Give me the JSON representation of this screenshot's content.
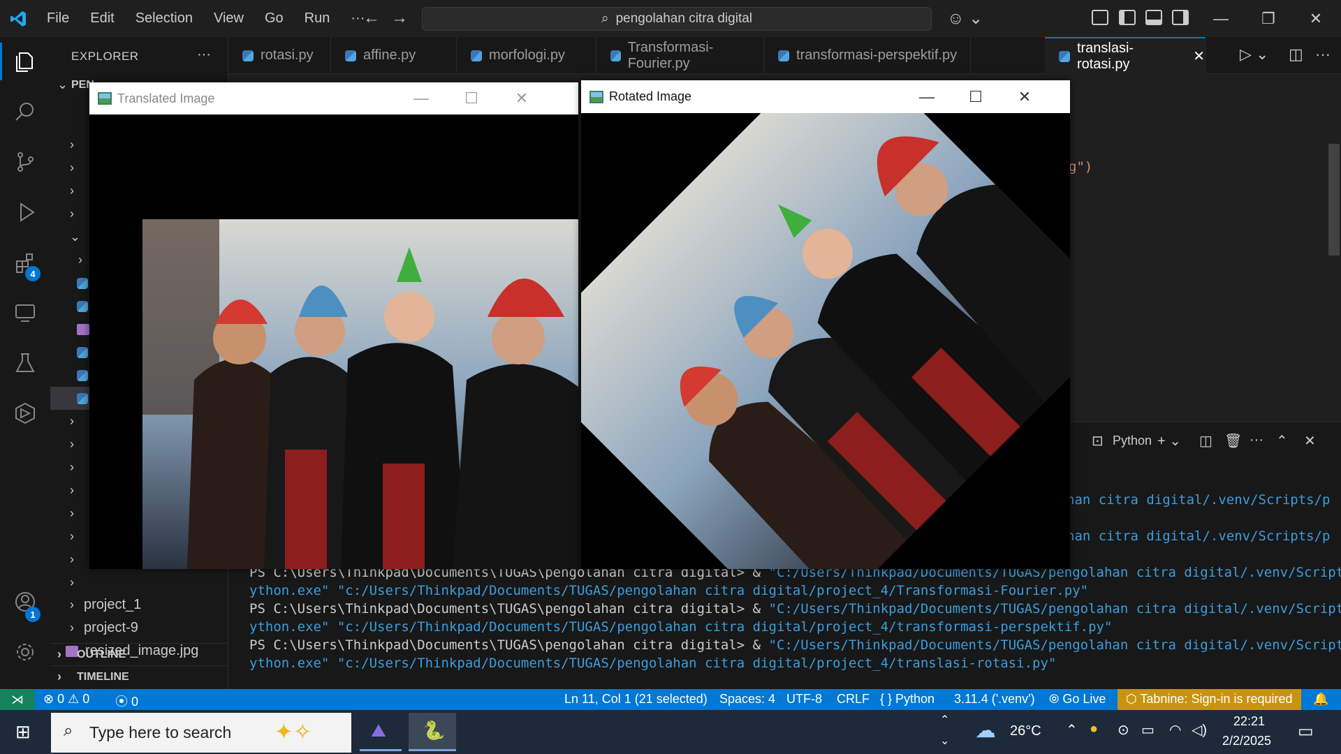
{
  "menu": [
    "File",
    "Edit",
    "Selection",
    "View",
    "Go",
    "Run",
    "···"
  ],
  "command_center": "pengolahan citra digital",
  "explorer": {
    "title": "EXPLORER",
    "root_label": "PEN",
    "items": [
      "project_1",
      "project-9",
      "resized_image.jpg"
    ],
    "outline": "OUTLINE",
    "timeline": "TIMELINE"
  },
  "tabs": [
    {
      "label": "rotasi.py"
    },
    {
      "label": "affine.py"
    },
    {
      "label": "morfologi.py"
    },
    {
      "label": "Transformasi-Fourier.py"
    },
    {
      "label": "transformasi-perspektif.py"
    },
    {
      "label": "translasi-rotasi.py"
    }
  ],
  "editor": {
    "visible_fragment": "g\")"
  },
  "badges": {
    "extensions": "4",
    "accounts": "1"
  },
  "panel": {
    "terminal_label": "Python",
    "lines": [
      {
        "plain": "",
        "str": "han citra digital/.venv/Scripts/p"
      },
      {
        "plain": "",
        "str": "han citra digital/.venv/Scripts/p"
      },
      {
        "plain": "PS C:\\Users\\Thinkpad\\Documents\\TUGAS\\pengolahan citra digital> & ",
        "str": "\"C:/Users/Thinkpad/Documents/TUGAS/pengolahan citra digital/.venv/Scripts/p"
      },
      {
        "plain": "",
        "str": "ython.exe\" \"c:/Users/Thinkpad/Documents/TUGAS/pengolahan citra digital/project_4/Transformasi-Fourier.py\""
      },
      {
        "plain": "PS C:\\Users\\Thinkpad\\Documents\\TUGAS\\pengolahan citra digital> & ",
        "str": "\"C:/Users/Thinkpad/Documents/TUGAS/pengolahan citra digital/.venv/Scripts/p"
      },
      {
        "plain": "",
        "str": "ython.exe\" \"c:/Users/Thinkpad/Documents/TUGAS/pengolahan citra digital/project_4/transformasi-perspektif.py\""
      },
      {
        "plain": "PS C:\\Users\\Thinkpad\\Documents\\TUGAS\\pengolahan citra digital> & ",
        "str": "\"C:/Users/Thinkpad/Documents/TUGAS/pengolahan citra digital/.venv/Scripts/p"
      },
      {
        "plain": "",
        "str": "ython.exe\" \"c:/Users/Thinkpad/Documents/TUGAS/pengolahan citra digital/project_4/translasi-rotasi.py\""
      }
    ]
  },
  "status": {
    "errors": "0",
    "warnings": "0",
    "ports": "0",
    "position": "Ln 11, Col 1 (21 selected)",
    "spaces": "Spaces: 4",
    "encoding": "UTF-8",
    "eol": "CRLF",
    "language": "Python",
    "interpreter": "3.11.4 ('.venv')",
    "golive": "Go Live",
    "tabnine": "Tabnine: Sign-in is required"
  },
  "windows": {
    "translated_title": "Translated Image",
    "rotated_title": "Rotated Image"
  },
  "taskbar": {
    "search_placeholder": "Type here to search",
    "temperature": "26°C",
    "time": "22:21",
    "date": "2/2/2025"
  },
  "colors": {
    "accent": "#0078d4",
    "remote": "#16825d",
    "terminal_string": "#3b9ede"
  }
}
